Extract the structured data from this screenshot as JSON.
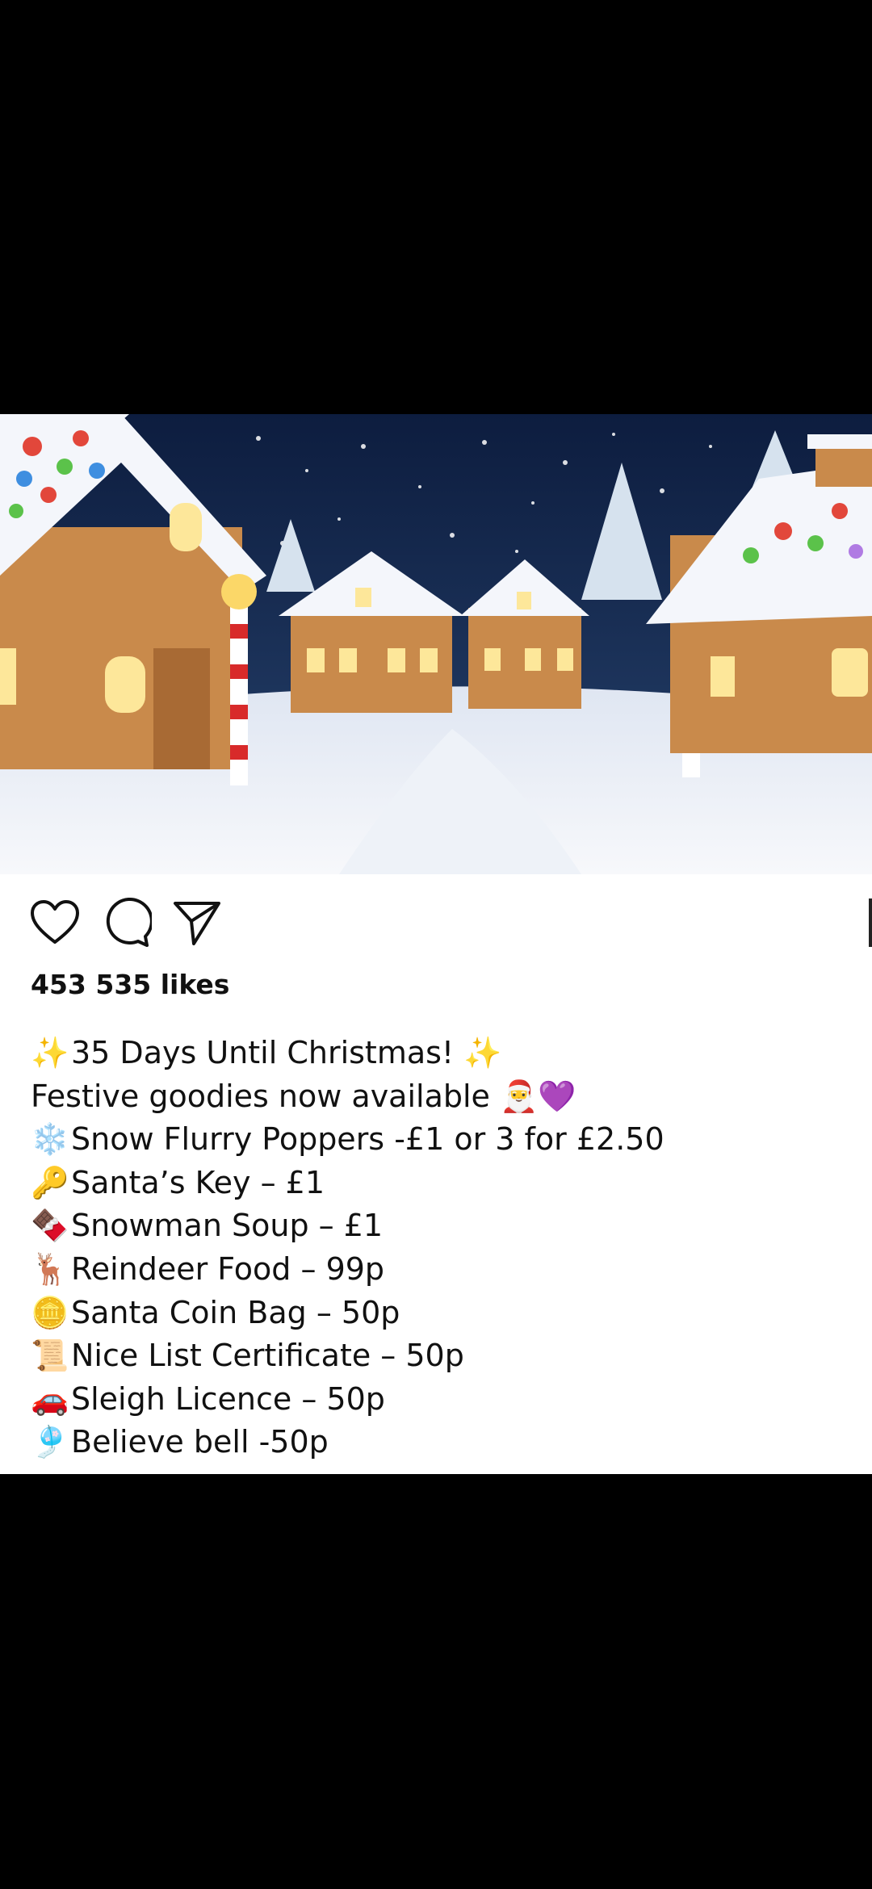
{
  "post": {
    "likes_text": "453 535 likes",
    "caption_lines": [
      {
        "emoji": "✨",
        "text": "35 Days Until Christmas! ✨"
      },
      {
        "emoji": "",
        "text": "Festive goodies now available 🎅💜"
      },
      {
        "emoji": "❄️",
        "text": "Snow Flurry Poppers -£1 or 3 for £2.50"
      },
      {
        "emoji": "🔑",
        "text": "Santa’s Key – £1"
      },
      {
        "emoji": "🍫",
        "text": "Snowman Soup – £1"
      },
      {
        "emoji": "🦌",
        "text": "Reindeer Food – 99p"
      },
      {
        "emoji": "🪙",
        "text": "Santa Coin Bag – 50p"
      },
      {
        "emoji": "📜",
        "text": "Nice List Certificate – 50p"
      },
      {
        "emoji": "🚗",
        "text": "Sleigh Licence – 50p"
      },
      {
        "emoji": "🎐",
        "text": "Believe bell -50p"
      }
    ]
  },
  "icons": {
    "like": "heart-outline-icon",
    "comment": "speech-bubble-icon",
    "share": "paper-plane-icon"
  },
  "colors": {
    "background": "#000000",
    "panel": "#ffffff",
    "text": "#111111",
    "snow": "#f4f6fb",
    "gingerbread": "#c98a4b",
    "night_sky": "#142a55"
  }
}
